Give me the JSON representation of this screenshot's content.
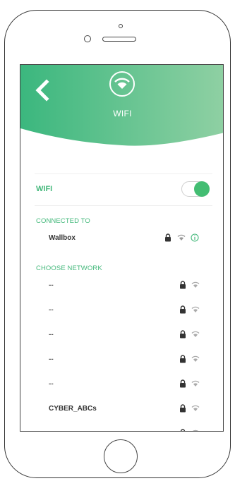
{
  "header": {
    "title": "WIFI",
    "gradient": [
      "#3bb77e",
      "#8fd0a3"
    ]
  },
  "wifi": {
    "label": "WIFI",
    "enabled": true,
    "accent": "#45b97c"
  },
  "connected": {
    "section_label": "CONNECTED TO",
    "network": "Wallbox",
    "icons": [
      "lock-icon",
      "wifi-signal-icon",
      "info-icon"
    ]
  },
  "choose": {
    "section_label": "CHOOSE NETWORK",
    "networks": [
      {
        "name": "--"
      },
      {
        "name": "--"
      },
      {
        "name": "--"
      },
      {
        "name": "--"
      },
      {
        "name": "--"
      },
      {
        "name": "CYBER_ABCs"
      }
    ],
    "row_icons": [
      "lock-icon",
      "wifi-signal-icon"
    ]
  }
}
